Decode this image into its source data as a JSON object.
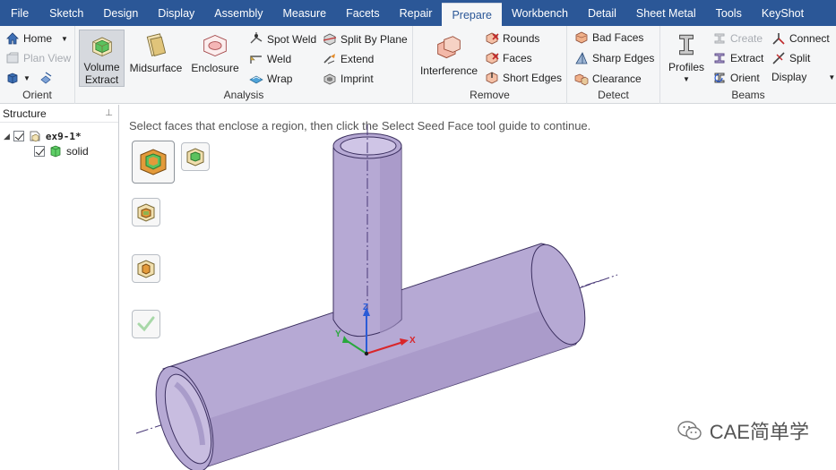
{
  "menu": {
    "tabs": [
      "File",
      "Sketch",
      "Design",
      "Display",
      "Assembly",
      "Measure",
      "Facets",
      "Repair",
      "Prepare",
      "Workbench",
      "Detail",
      "Sheet Metal",
      "Tools",
      "KeyShot"
    ],
    "active": "Prepare"
  },
  "ribbon": {
    "orient": {
      "label": "Orient",
      "home": "Home",
      "plan_view": "Plan View"
    },
    "analysis": {
      "label": "Analysis",
      "volume_extract": "Volume Extract",
      "midsurface": "Midsurface",
      "enclosure": "Enclosure",
      "spot_weld": "Spot Weld",
      "weld": "Weld",
      "wrap": "Wrap",
      "split_by_plane": "Split By Plane",
      "extend": "Extend",
      "imprint": "Imprint"
    },
    "remove": {
      "label": "Remove",
      "interference": "Interference",
      "rounds": "Rounds",
      "faces": "Faces",
      "short_edges": "Short Edges"
    },
    "detect": {
      "label": "Detect",
      "bad_faces": "Bad Faces",
      "sharp_edges": "Sharp Edges",
      "clearance": "Clearance"
    },
    "beams": {
      "label": "Beams",
      "profiles": "Profiles",
      "create": "Create",
      "extract": "Extract",
      "orient": "Orient",
      "connect": "Connect",
      "split": "Split",
      "display": "Display"
    }
  },
  "structure": {
    "title": "Structure",
    "root": "ex9-1*",
    "child": "solid"
  },
  "viewport": {
    "hint": "Select faces that enclose a region, then click the Select Seed Face tool guide to continue.",
    "axes": {
      "x": "X",
      "y": "Y",
      "z": "Z"
    }
  },
  "watermark": "CAE简单学",
  "colors": {
    "menubar": "#2b5797",
    "ribbon": "#f5f6f7",
    "pipe": "#b4a6d2",
    "pipe_dark": "#8e7fb5",
    "axis_x": "#d9262a",
    "axis_y": "#28a83c",
    "axis_z": "#2a5bd7"
  }
}
